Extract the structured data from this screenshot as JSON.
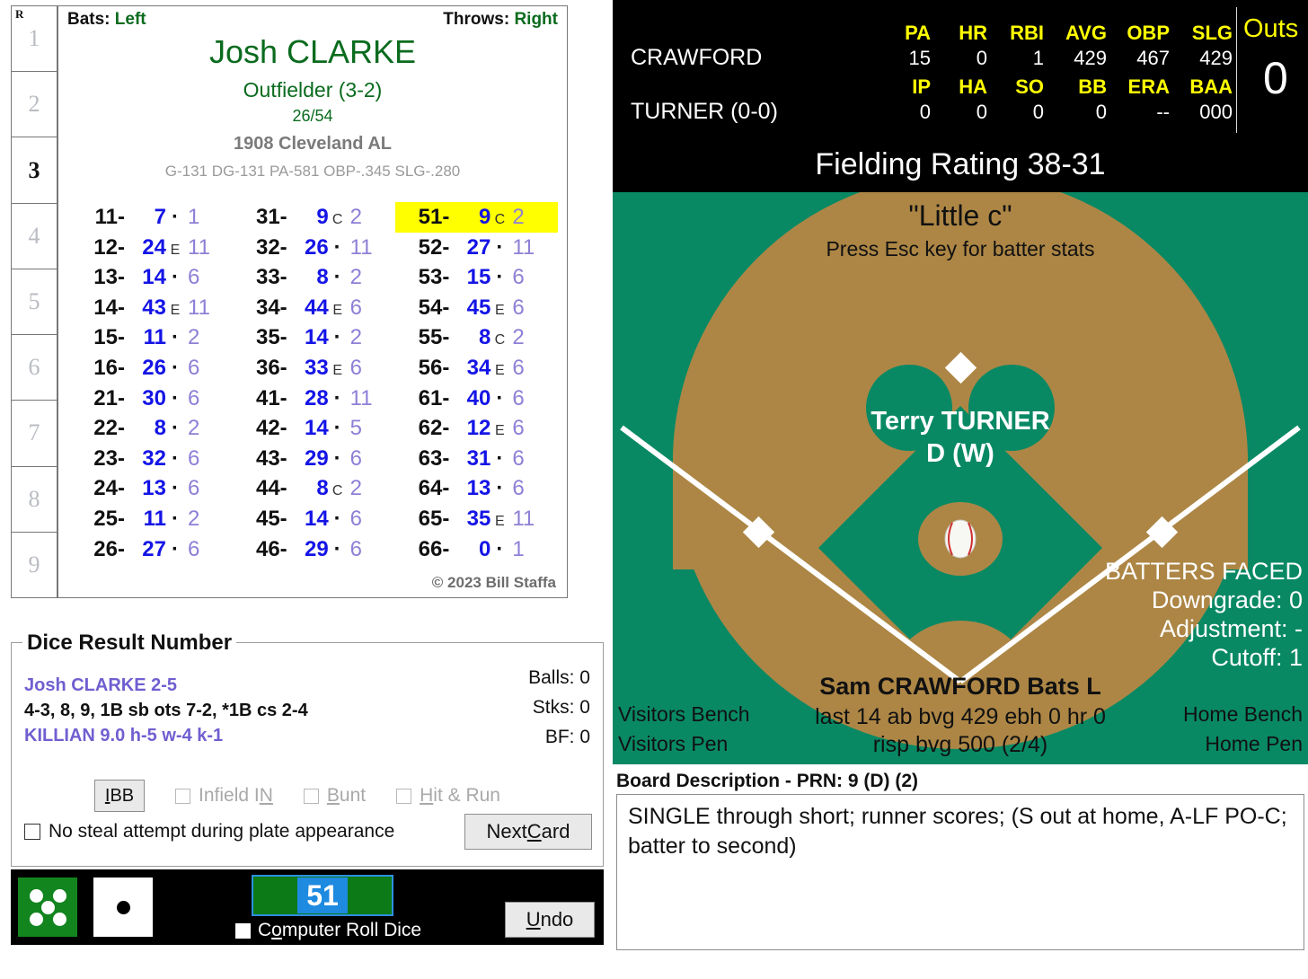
{
  "innings": {
    "header": "R",
    "cells": [
      "1",
      "2",
      "3",
      "4",
      "5",
      "6",
      "7",
      "8",
      "9"
    ],
    "active_index": 2
  },
  "player_card": {
    "bats_label": "Bats:",
    "bats_value": "Left",
    "throws_label": "Throws:",
    "throws_value": "Right",
    "name": "Josh CLARKE",
    "position": "Outfielder (3-2)",
    "fraction": "26/54",
    "team": "1908 Cleveland AL",
    "stat_line": "G-131 DG-131 PA-581 OBP-.345 SLG-.280",
    "copyright": "© 2023 Bill Staffa",
    "highlight_key": "51",
    "columns": [
      [
        {
          "key": "11",
          "res": "7",
          "mid": "-",
          "sub": "1"
        },
        {
          "key": "12",
          "res": "24",
          "mid": "E",
          "sub": "11"
        },
        {
          "key": "13",
          "res": "14",
          "mid": "-",
          "sub": "6"
        },
        {
          "key": "14",
          "res": "43",
          "mid": "E",
          "sub": "11"
        },
        {
          "key": "15",
          "res": "11",
          "mid": "-",
          "sub": "2"
        },
        {
          "key": "16",
          "res": "26",
          "mid": "-",
          "sub": "6"
        },
        {
          "key": "21",
          "res": "30",
          "mid": "-",
          "sub": "6"
        },
        {
          "key": "22",
          "res": "8",
          "mid": "-",
          "sub": "2"
        },
        {
          "key": "23",
          "res": "32",
          "mid": "-",
          "sub": "6"
        },
        {
          "key": "24",
          "res": "13",
          "mid": "-",
          "sub": "6"
        },
        {
          "key": "25",
          "res": "11",
          "mid": "-",
          "sub": "2"
        },
        {
          "key": "26",
          "res": "27",
          "mid": "-",
          "sub": "6"
        }
      ],
      [
        {
          "key": "31",
          "res": "9",
          "mid": "C",
          "sub": "2"
        },
        {
          "key": "32",
          "res": "26",
          "mid": "-",
          "sub": "11"
        },
        {
          "key": "33",
          "res": "8",
          "mid": "-",
          "sub": "2"
        },
        {
          "key": "34",
          "res": "44",
          "mid": "E",
          "sub": "6"
        },
        {
          "key": "35",
          "res": "14",
          "mid": "-",
          "sub": "2"
        },
        {
          "key": "36",
          "res": "33",
          "mid": "E",
          "sub": "6"
        },
        {
          "key": "41",
          "res": "28",
          "mid": "-",
          "sub": "11"
        },
        {
          "key": "42",
          "res": "14",
          "mid": "-",
          "sub": "5"
        },
        {
          "key": "43",
          "res": "29",
          "mid": "-",
          "sub": "6"
        },
        {
          "key": "44",
          "res": "8",
          "mid": "C",
          "sub": "2"
        },
        {
          "key": "45",
          "res": "14",
          "mid": "-",
          "sub": "6"
        },
        {
          "key": "46",
          "res": "29",
          "mid": "-",
          "sub": "6"
        }
      ],
      [
        {
          "key": "51",
          "res": "9",
          "mid": "C",
          "sub": "2"
        },
        {
          "key": "52",
          "res": "27",
          "mid": "-",
          "sub": "11"
        },
        {
          "key": "53",
          "res": "15",
          "mid": "-",
          "sub": "6"
        },
        {
          "key": "54",
          "res": "45",
          "mid": "E",
          "sub": "6"
        },
        {
          "key": "55",
          "res": "8",
          "mid": "C",
          "sub": "2"
        },
        {
          "key": "56",
          "res": "34",
          "mid": "E",
          "sub": "6"
        },
        {
          "key": "61",
          "res": "40",
          "mid": "-",
          "sub": "6"
        },
        {
          "key": "62",
          "res": "12",
          "mid": "E",
          "sub": "6"
        },
        {
          "key": "63",
          "res": "31",
          "mid": "-",
          "sub": "6"
        },
        {
          "key": "64",
          "res": "13",
          "mid": "-",
          "sub": "6"
        },
        {
          "key": "65",
          "res": "35",
          "mid": "E",
          "sub": "11"
        },
        {
          "key": "66",
          "res": "0",
          "mid": "-",
          "sub": "1"
        }
      ]
    ]
  },
  "dice_result": {
    "title": "Dice Result Number",
    "line1": "Josh CLARKE  2-5",
    "line2": "4-3, 8, 9, 1B sb ots 7-2, *1B cs 2-4",
    "line3": "KILLIAN  9.0  h-5  w-4  k-1",
    "balls": "Balls: 0",
    "strikes": "Stks: 0",
    "bf": "BF: 0",
    "ibb_label": "IBB",
    "ibb_accel": "I",
    "options": [
      {
        "label_pre": "Infield I",
        "accel": "N",
        "label_post": "",
        "enabled": false
      },
      {
        "label_pre": "",
        "accel": "B",
        "label_post": "unt",
        "enabled": false
      },
      {
        "label_pre": "",
        "accel": "H",
        "label_post": "it & Run",
        "enabled": false
      }
    ],
    "no_steal_label": "No steal attempt during plate appearance",
    "no_steal_checked": false,
    "next_card_pre": "Next ",
    "next_card_accel": "C",
    "next_card_post": "ard"
  },
  "dice_bar": {
    "green_die": 5,
    "white_die": 1,
    "roll_value": "51",
    "computer_roll_pre": "C",
    "computer_roll_accel": "o",
    "computer_roll_post": "mputer Roll Dice",
    "computer_roll_checked": false,
    "undo_accel": "U",
    "undo_post": "ndo"
  },
  "scorebar": {
    "batter_headers": [
      "PA",
      "HR",
      "RBI",
      "AVG",
      "OBP",
      "SLG"
    ],
    "batter_name": "CRAWFORD",
    "batter_values": [
      "15",
      "0",
      "1",
      "429",
      "467",
      "429"
    ],
    "pitcher_headers": [
      "IP",
      "HA",
      "SO",
      "BB",
      "ERA",
      "BAA"
    ],
    "pitcher_name": "TURNER (0-0)",
    "pitcher_values": [
      "0",
      "0",
      "0",
      "0",
      "--",
      "000"
    ],
    "outs_label": "Outs",
    "outs_value": "0"
  },
  "field": {
    "fielding_rating": "Fielding Rating 38-31",
    "little_c": "\"Little c\"",
    "press_esc": "Press Esc key for batter stats",
    "fielder_name": "Terry TURNER",
    "fielder_pos": "D (W)",
    "batters_faced_title": "BATTERS FACED",
    "downgrade": "Downgrade: 0",
    "adjustment": "Adjustment: -",
    "cutoff": "Cutoff: 1",
    "batter_name": "Sam CRAWFORD Bats L",
    "batter_line2": "last 14 ab bvg 429 ebh 0 hr 0",
    "batter_line3": "risp bvg 500 (2/4)",
    "visitors_bench": "Visitors Bench",
    "visitors_pen": "Visitors Pen",
    "home_bench": "Home Bench",
    "home_pen": "Home Pen",
    "grass_color": "#088964",
    "dirt_color": "#AD8645"
  },
  "board": {
    "title": "Board Description - PRN: 9 (D) (2)",
    "text": "SINGLE through short; runner scores; (S out at home, A-LF PO-C; batter to second)"
  }
}
